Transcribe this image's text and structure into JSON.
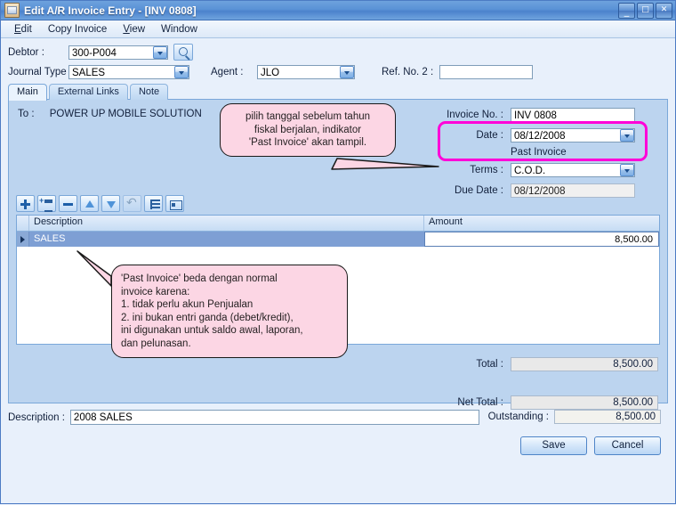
{
  "window": {
    "title": "Edit A/R Invoice Entry - [INV 0808]",
    "icon": "invoice-document-icon",
    "controls": {
      "minimize": "_",
      "maximize": "□",
      "close": "✕"
    }
  },
  "menu": {
    "items": [
      "Edit",
      "Copy Invoice",
      "View",
      "Window"
    ]
  },
  "header": {
    "debtor_label": "Debtor :",
    "debtor_value": "300-P004",
    "search_icon": "magnifier-icon",
    "journal_type_label": "Journal Type :",
    "journal_type_value": "SALES",
    "agent_label": "Agent :",
    "agent_value": "JLO",
    "ref_no2_label": "Ref. No. 2 :",
    "ref_no2_value": ""
  },
  "tabs": [
    {
      "label": "Main",
      "active": true
    },
    {
      "label": "External Links",
      "active": false
    },
    {
      "label": "Note",
      "active": false
    }
  ],
  "main": {
    "to_label": "To :",
    "to_value": "POWER UP MOBILE SOLUTION",
    "invoice_no_label": "Invoice No. :",
    "invoice_no_value": "INV 0808",
    "date_label": "Date :",
    "date_value": "08/12/2008",
    "past_invoice_indicator": "Past Invoice",
    "terms_label": "Terms :",
    "terms_value": "C.O.D.",
    "due_date_label": "Due Date :",
    "due_date_value": "08/12/2008",
    "highlight_color": "#ff00d8"
  },
  "grid_toolbar": [
    {
      "name": "add-row-icon",
      "disabled": false
    },
    {
      "name": "insert-row-icon",
      "disabled": false
    },
    {
      "name": "delete-row-icon",
      "disabled": false
    },
    {
      "name": "move-up-icon",
      "disabled": false
    },
    {
      "name": "move-down-icon",
      "disabled": false
    },
    {
      "name": "undo-icon",
      "disabled": true
    },
    {
      "name": "indent-list-icon",
      "disabled": false
    },
    {
      "name": "row-detail-icon",
      "disabled": false
    }
  ],
  "grid": {
    "columns": [
      "Description",
      "Amount"
    ],
    "rows": [
      {
        "description": "SALES",
        "amount": "8,500.00",
        "selected": true
      }
    ]
  },
  "totals": {
    "total_label": "Total :",
    "total_value": "8,500.00",
    "net_total_label": "Net Total :",
    "net_total_value": "8,500.00"
  },
  "footer": {
    "description_label": "Description :",
    "description_value": "2008 SALES",
    "outstanding_label": "Outstanding :",
    "outstanding_value": "8,500.00",
    "save_label": "Save",
    "cancel_label": "Cancel"
  },
  "callouts": {
    "one": {
      "line1": "pilih tanggal sebelum tahun",
      "line2": "fiskal berjalan, indikator",
      "line3": "'Past Invoice' akan tampil."
    },
    "two": {
      "line1": "'Past Invoice' beda dengan normal",
      "line2": "invoice karena:",
      "line3": "1. tidak perlu akun Penjualan",
      "line4": "2. ini bukan entri ganda (debet/kredit),",
      "line5": "ini digunakan untuk saldo awal, laporan,",
      "line6": "dan pelunasan."
    }
  }
}
